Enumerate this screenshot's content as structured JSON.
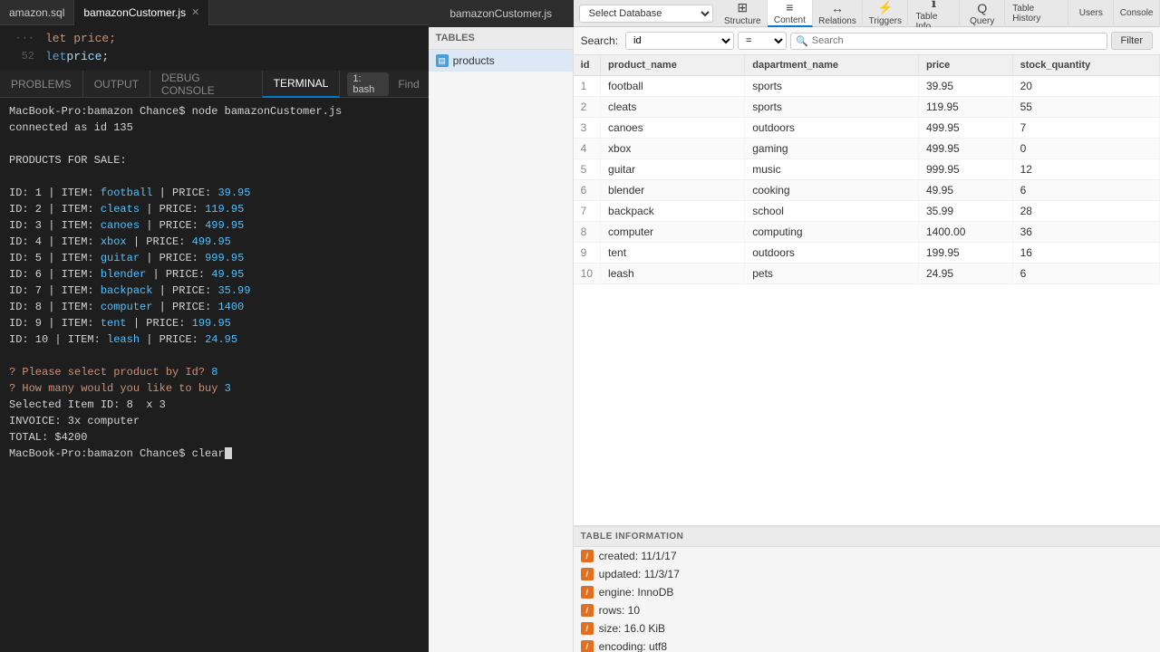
{
  "editor": {
    "tabs": [
      {
        "id": "amazon-sql",
        "label": "amazon.sql",
        "active": false,
        "closeable": false
      },
      {
        "id": "bamazon-customer-js",
        "label": "bamazonCustomer.js",
        "active": true,
        "closeable": true
      }
    ],
    "line_number": "52",
    "code": "let price;"
  },
  "terminal": {
    "tabs": [
      {
        "label": "PROBLEMS",
        "active": false
      },
      {
        "label": "OUTPUT",
        "active": false
      },
      {
        "label": "DEBUG CONSOLE",
        "active": false
      },
      {
        "label": "TERMINAL",
        "active": true
      }
    ],
    "bash_label": "1: bash",
    "find_label": "Find",
    "lines": [
      "MacBook-Pro:bamazon Chance$ node bamazonCustomer.js",
      "connected as id 135",
      "",
      "PRODUCTS FOR SALE:",
      "",
      "ID: 1 | ITEM: football | PRICE: 39.95",
      "ID: 2 | ITEM: cleats | PRICE: 119.95",
      "ID: 3 | ITEM: canoes | PRICE: 499.95",
      "ID: 4 | ITEM: xbox | PRICE: 499.95",
      "ID: 5 | ITEM: guitar | PRICE: 999.95",
      "ID: 6 | ITEM: blender | PRICE: 49.95",
      "ID: 7 | ITEM: backpack | PRICE: 35.99",
      "ID: 8 | ITEM: computer | PRICE: 1400",
      "ID: 9 | ITEM: tent | PRICE: 199.95",
      "ID: 10 | ITEM: leash | PRICE: 24.95",
      "",
      "? Please select product by Id? 8",
      "? How many would you like to buy 3",
      "Selected Item ID: 8  x 3",
      "INVOICE: 3x computer",
      "TOTAL: $4200",
      "MacBook-Pro:bamazon Chance$ clear"
    ]
  },
  "db": {
    "topbar_filename": "bamazonCustomer.js",
    "select_database_label": "Select Database",
    "nav_items": [
      {
        "id": "structure",
        "icon": "⊞",
        "label": "Structure"
      },
      {
        "id": "content",
        "icon": "≡",
        "label": "Content"
      },
      {
        "id": "relations",
        "icon": "↔",
        "label": "Relations"
      },
      {
        "id": "triggers",
        "icon": "⚡",
        "label": "Triggers"
      },
      {
        "id": "table-info",
        "icon": "ℹ",
        "label": "Table Info"
      },
      {
        "id": "query",
        "icon": "Q",
        "label": "Query"
      }
    ],
    "extra_nav": [
      {
        "id": "table-history",
        "label": "Table History"
      },
      {
        "id": "users",
        "label": "Users"
      },
      {
        "id": "console",
        "label": "Console"
      }
    ],
    "tables_header": "TABLES",
    "tables": [
      {
        "id": "products",
        "name": "products",
        "active": true
      }
    ],
    "search": {
      "label": "Search:",
      "field_value": "id",
      "operator_value": "=",
      "placeholder": "Search",
      "filter_label": "Filter"
    },
    "table_columns": [
      "id",
      "product_name",
      "dapartment_name",
      "price",
      "stock_quantity"
    ],
    "table_rows": [
      {
        "id": "1",
        "product_name": "football",
        "dapartment_name": "sports",
        "price": "39.95",
        "stock_quantity": "20"
      },
      {
        "id": "2",
        "product_name": "cleats",
        "dapartment_name": "sports",
        "price": "119.95",
        "stock_quantity": "55"
      },
      {
        "id": "3",
        "product_name": "canoes",
        "dapartment_name": "outdoors",
        "price": "499.95",
        "stock_quantity": "7"
      },
      {
        "id": "4",
        "product_name": "xbox",
        "dapartment_name": "gaming",
        "price": "499.95",
        "stock_quantity": "0"
      },
      {
        "id": "5",
        "product_name": "guitar",
        "dapartment_name": "music",
        "price": "999.95",
        "stock_quantity": "12"
      },
      {
        "id": "6",
        "product_name": "blender",
        "dapartment_name": "cooking",
        "price": "49.95",
        "stock_quantity": "6"
      },
      {
        "id": "7",
        "product_name": "backpack",
        "dapartment_name": "school",
        "price": "35.99",
        "stock_quantity": "28"
      },
      {
        "id": "8",
        "product_name": "computer",
        "dapartment_name": "computing",
        "price": "1400.00",
        "stock_quantity": "36"
      },
      {
        "id": "9",
        "product_name": "tent",
        "dapartment_name": "outdoors",
        "price": "199.95",
        "stock_quantity": "16"
      },
      {
        "id": "10",
        "product_name": "leash",
        "dapartment_name": "pets",
        "price": "24.95",
        "stock_quantity": "6"
      }
    ],
    "table_info_header": "TABLE INFORMATION",
    "table_info_items": [
      {
        "label": "created: 11/1/17"
      },
      {
        "label": "updated: 11/3/17"
      },
      {
        "label": "engine: InnoDB"
      },
      {
        "label": "rows: 10"
      },
      {
        "label": "size: 16.0 KiB"
      },
      {
        "label": "encoding: utf8"
      }
    ]
  }
}
